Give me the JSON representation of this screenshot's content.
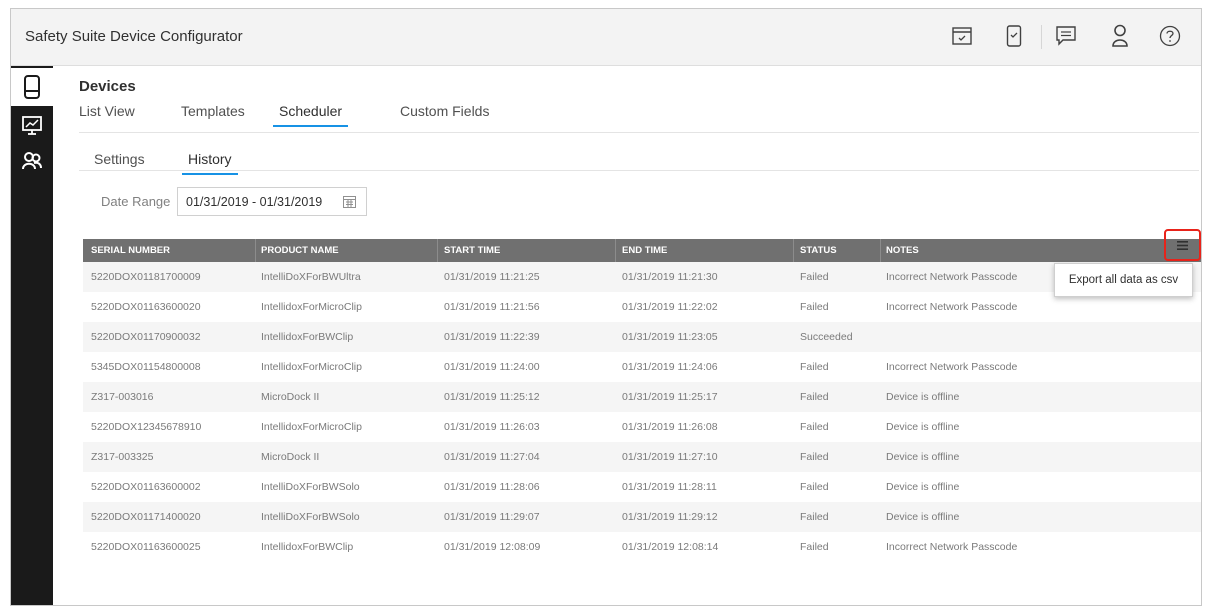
{
  "app": {
    "title": "Safety Suite Device Configurator"
  },
  "toolbar_icons": [
    "screen-check-icon",
    "device-check-icon",
    "chat-icon",
    "user-icon",
    "help-icon"
  ],
  "sidebar": {
    "items": [
      {
        "icon": "device-icon",
        "active": true
      },
      {
        "icon": "presentation-chart-icon",
        "active": false
      },
      {
        "icon": "users-group-icon",
        "active": false
      }
    ]
  },
  "page": {
    "title": "Devices",
    "tabs": [
      "List View",
      "Templates",
      "Scheduler",
      "Custom Fields"
    ],
    "active_tab": "Scheduler",
    "subtabs": [
      "Settings",
      "History"
    ],
    "active_subtab": "History"
  },
  "filter": {
    "date_label": "Date Range",
    "date_value": "01/31/2019 - 01/31/2019"
  },
  "table": {
    "columns": [
      "SERIAL NUMBER",
      "PRODUCT NAME",
      "START TIME",
      "END TIME",
      "STATUS",
      "NOTES"
    ],
    "rows": [
      [
        "5220DOX01181700009",
        "IntelliDoXForBWUltra",
        "01/31/2019 11:21:25",
        "01/31/2019 11:21:30",
        "Failed",
        "Incorrect Network Passcode"
      ],
      [
        "5220DOX01163600020",
        "IntellidoxForMicroClip",
        "01/31/2019 11:21:56",
        "01/31/2019 11:22:02",
        "Failed",
        "Incorrect Network Passcode"
      ],
      [
        "5220DOX01170900032",
        "IntellidoxForBWClip",
        "01/31/2019 11:22:39",
        "01/31/2019 11:23:05",
        "Succeeded",
        ""
      ],
      [
        "5345DOX01154800008",
        "IntellidoxForMicroClip",
        "01/31/2019 11:24:00",
        "01/31/2019 11:24:06",
        "Failed",
        "Incorrect Network Passcode"
      ],
      [
        "Z317-003016",
        "MicroDock II",
        "01/31/2019 11:25:12",
        "01/31/2019 11:25:17",
        "Failed",
        "Device is offline"
      ],
      [
        "5220DOX12345678910",
        "IntellidoxForMicroClip",
        "01/31/2019 11:26:03",
        "01/31/2019 11:26:08",
        "Failed",
        "Device is offline"
      ],
      [
        "Z317-003325",
        "MicroDock II",
        "01/31/2019 11:27:04",
        "01/31/2019 11:27:10",
        "Failed",
        "Device is offline"
      ],
      [
        "5220DOX01163600002",
        "IntelliDoXForBWSolo",
        "01/31/2019 11:28:06",
        "01/31/2019 11:28:11",
        "Failed",
        "Device is offline"
      ],
      [
        "5220DOX01171400020",
        "IntelliDoXForBWSolo",
        "01/31/2019 11:29:07",
        "01/31/2019 11:29:12",
        "Failed",
        "Device is offline"
      ],
      [
        "5220DOX01163600025",
        "IntellidoxForBWClip",
        "01/31/2019 12:08:09",
        "01/31/2019 12:08:14",
        "Failed",
        "Incorrect Network Passcode"
      ]
    ]
  },
  "export_menu": {
    "item": "Export all data as csv"
  },
  "colors": {
    "accent": "#1792e5",
    "header_bg": "#707070",
    "sidebar_bg": "#1a1a1a",
    "highlight": "#e8231a"
  }
}
